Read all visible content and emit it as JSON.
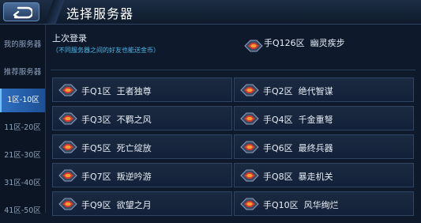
{
  "header": {
    "title": "选择服务器"
  },
  "sidebar": {
    "items": [
      {
        "label": "我的服务器",
        "active": false
      },
      {
        "label": "推荐服务器",
        "active": false
      },
      {
        "label": "1区-10区",
        "active": true
      },
      {
        "label": "11区-20区",
        "active": false
      },
      {
        "label": "21区-30区",
        "active": false
      },
      {
        "label": "31区-40区",
        "active": false
      },
      {
        "label": "41区-50区",
        "active": false
      }
    ]
  },
  "last_login": {
    "label": "上次登录",
    "note": "（不同服务器之间的好友也能送金币）",
    "server": {
      "zone": "手Q126区",
      "name": "幽灵疾步"
    }
  },
  "servers": [
    {
      "zone": "手Q1区",
      "name": "王者独尊"
    },
    {
      "zone": "手Q2区",
      "name": "绝代智谋"
    },
    {
      "zone": "手Q3区",
      "name": "不羁之风"
    },
    {
      "zone": "手Q4区",
      "name": "千金重弩"
    },
    {
      "zone": "手Q5区",
      "name": "死亡绽放"
    },
    {
      "zone": "手Q6区",
      "name": "最终兵器"
    },
    {
      "zone": "手Q7区",
      "name": "叛逆吟游"
    },
    {
      "zone": "手Q8区",
      "name": "暴走机关"
    },
    {
      "zone": "手Q9区",
      "name": "欲望之月"
    },
    {
      "zone": "手Q10区",
      "name": "风华绚烂"
    }
  ],
  "colors": {
    "accent": "#2e6ec0",
    "note": "#4fb6e8",
    "icon_red": "#d6372e"
  },
  "icons": {
    "back": "back-arrow-icon",
    "server": "server-emblem-icon"
  }
}
